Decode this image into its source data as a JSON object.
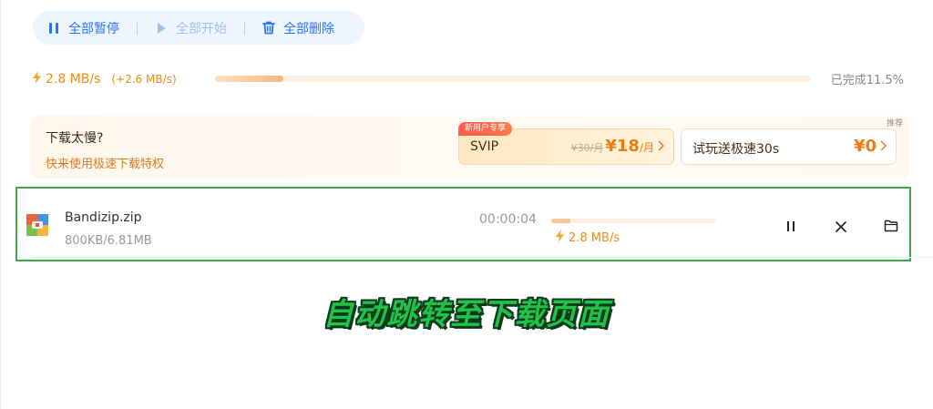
{
  "toolbar": {
    "pause_all": "全部暂停",
    "start_all": "全部开始",
    "delete_all": "全部删除"
  },
  "speed": {
    "current": "2.8 MB/s",
    "boost": "(+2.6 MB/s)",
    "overall_progress": 0.115,
    "completed_label": "已完成11.5%"
  },
  "promo": {
    "title": "下载太慢?",
    "subtitle": "快来使用极速下载特权",
    "tag": "推荐",
    "svip": {
      "badge": "新用户专享",
      "name": "SVIP",
      "old_price": "¥30/月",
      "price": "¥18",
      "unit": "/月"
    },
    "trial": {
      "name": "试玩送极速30s",
      "price": "¥0"
    }
  },
  "download": {
    "file_name": "Bandizip.zip",
    "size": "800KB/6.81MB",
    "elapsed": "00:00:04",
    "progress": 0.115,
    "speed": "2.8 MB/s"
  },
  "caption": "自动跳转至下载页面",
  "colors": {
    "accent": "#2b73ff",
    "orange": "#e88c1a",
    "highlight_border": "#3daa4a",
    "caption_fill": "#22c14a"
  },
  "icons": {
    "pause": "pause-icon",
    "play": "play-icon",
    "trash": "trash-icon",
    "bolt": "lightning-icon",
    "close": "close-icon",
    "folder": "folder-icon",
    "archive": "zip-archive-icon"
  }
}
